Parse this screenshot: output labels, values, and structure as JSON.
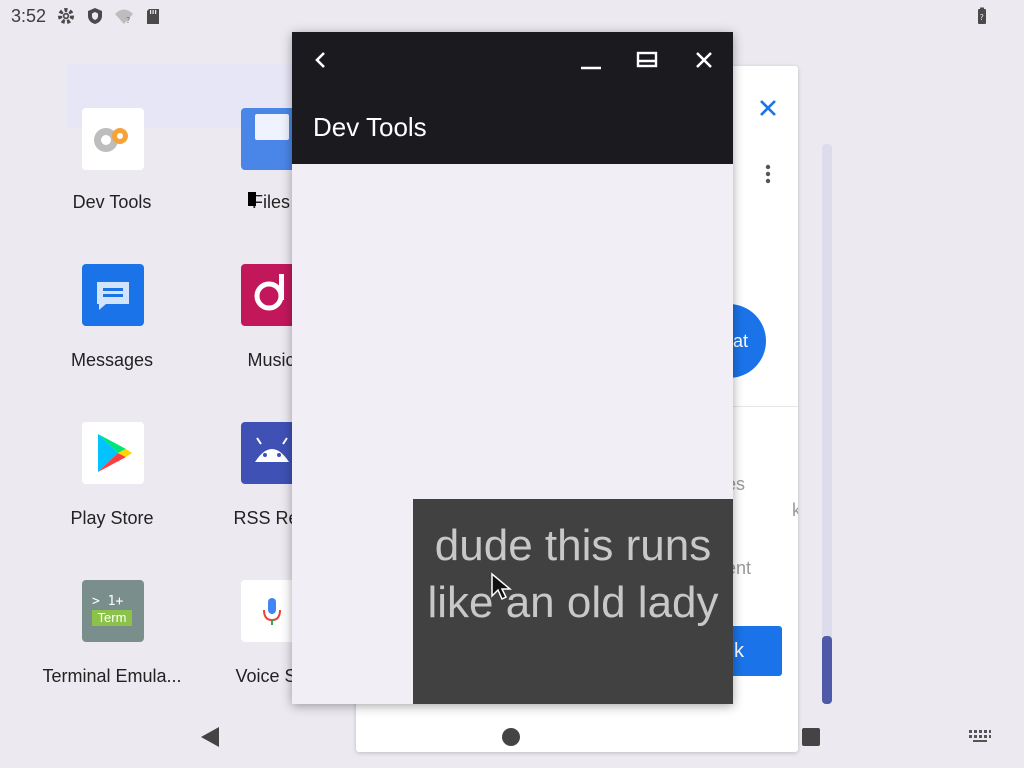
{
  "status_bar": {
    "time": "3:52",
    "icons": [
      "settings-icon",
      "shield-icon",
      "wifi-off-icon",
      "sd-card-icon",
      "battery-unknown-icon"
    ]
  },
  "launcher": {
    "apps": [
      {
        "label": "Dev Tools",
        "icon": "dev-tools-icon"
      },
      {
        "label": "Files",
        "icon": "files-icon"
      },
      {
        "label": "Messages",
        "icon": "messages-icon"
      },
      {
        "label": "Music",
        "icon": "music-icon"
      },
      {
        "label": "Play Store",
        "icon": "play-store-icon"
      },
      {
        "label": "RSS Rea",
        "icon": "rss-reader-icon"
      },
      {
        "label": "Terminal Emula...",
        "icon": "terminal-icon",
        "icon_text": "> 1+\nTerm"
      },
      {
        "label": "Voice Se",
        "icon": "voice-search-icon"
      }
    ]
  },
  "background_dialog": {
    "fab_label": "at",
    "text_1": "es",
    "text_2": "k",
    "text_3": "ent",
    "button_label": "k"
  },
  "dev_tools_window": {
    "title": "Dev Tools",
    "toast": "dude this runs like an old lady"
  },
  "colors": {
    "window_header": "#1b1b1f",
    "accent": "#1a73e8",
    "toast_bg": "#414141"
  }
}
